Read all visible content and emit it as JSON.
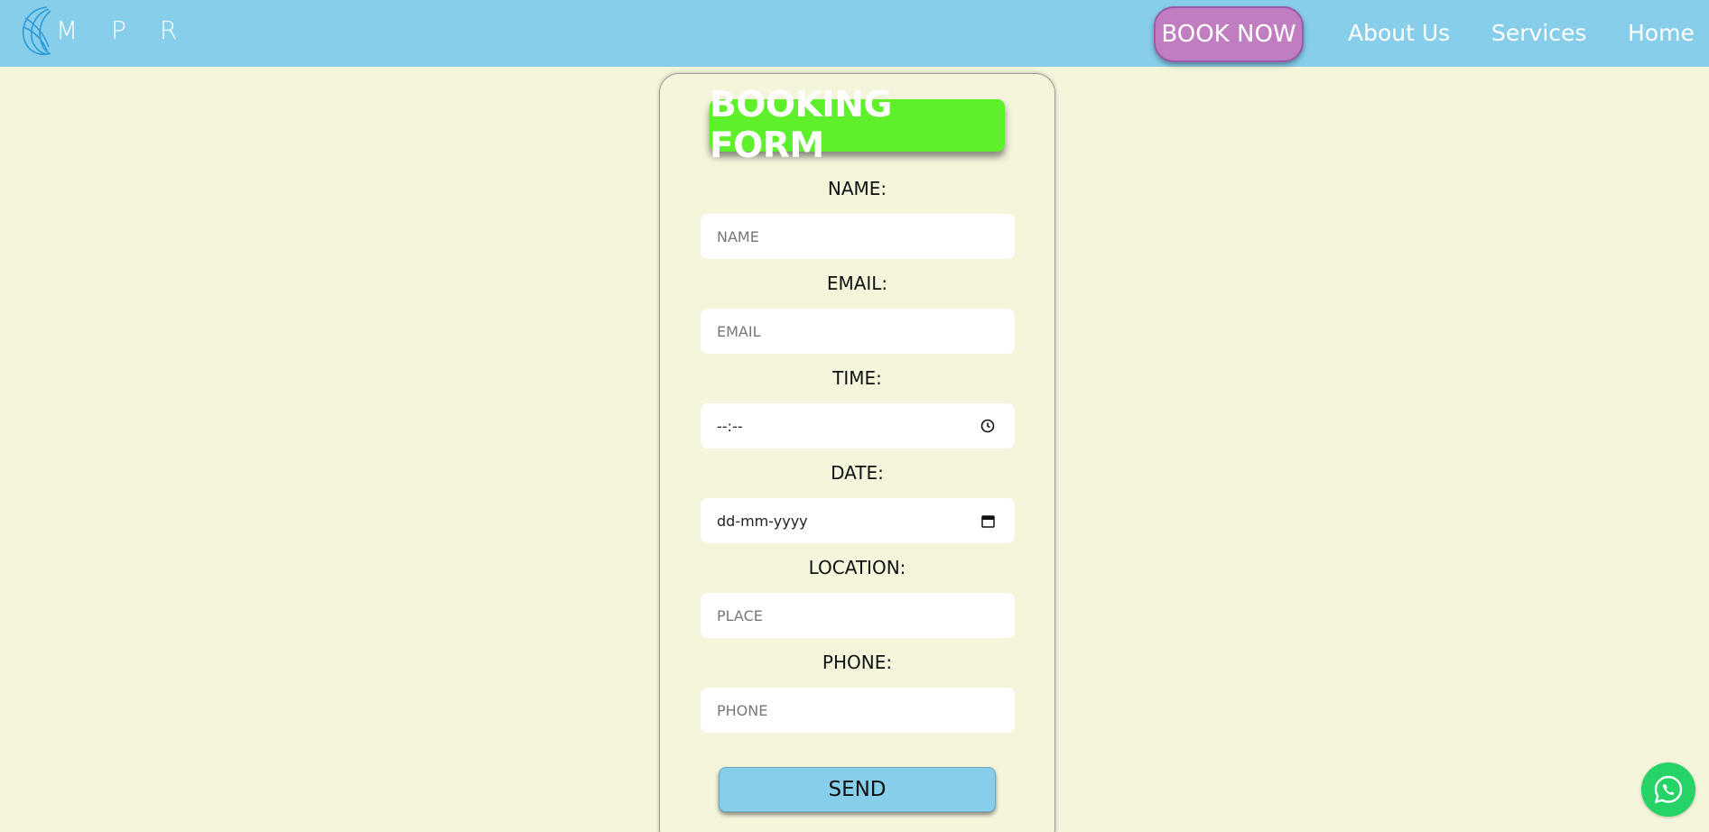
{
  "header": {
    "logo_text": "M P R",
    "nav": {
      "book_now": "BOOK NOW",
      "about": "About Us",
      "services": "Services",
      "home": "Home"
    }
  },
  "form": {
    "title": "BOOKING FORM",
    "fields": {
      "name": {
        "label": "NAME:",
        "placeholder": "NAME"
      },
      "email": {
        "label": "EMAIL:",
        "placeholder": "EMAIL"
      },
      "time": {
        "label": "TIME:",
        "value": "--:--"
      },
      "date": {
        "label": "DATE:",
        "value": "dd-mm-yyyy"
      },
      "location": {
        "label": "LOCATION:",
        "placeholder": "PLACE"
      },
      "phone": {
        "label": "PHONE:",
        "placeholder": "PHONE"
      }
    },
    "submit_label": "SEND"
  },
  "colors": {
    "page_bg": "#f5f5dc",
    "header_bg": "#87ceeb",
    "book_now_bg": "#c07ec0",
    "title_bg": "#5ef02a",
    "send_bg": "#87ceeb",
    "whatsapp_bg": "#25d366"
  },
  "icons": {
    "logo": "globe-logo-icon",
    "time": "clock-icon",
    "date": "calendar-icon",
    "chat": "whatsapp-icon"
  }
}
